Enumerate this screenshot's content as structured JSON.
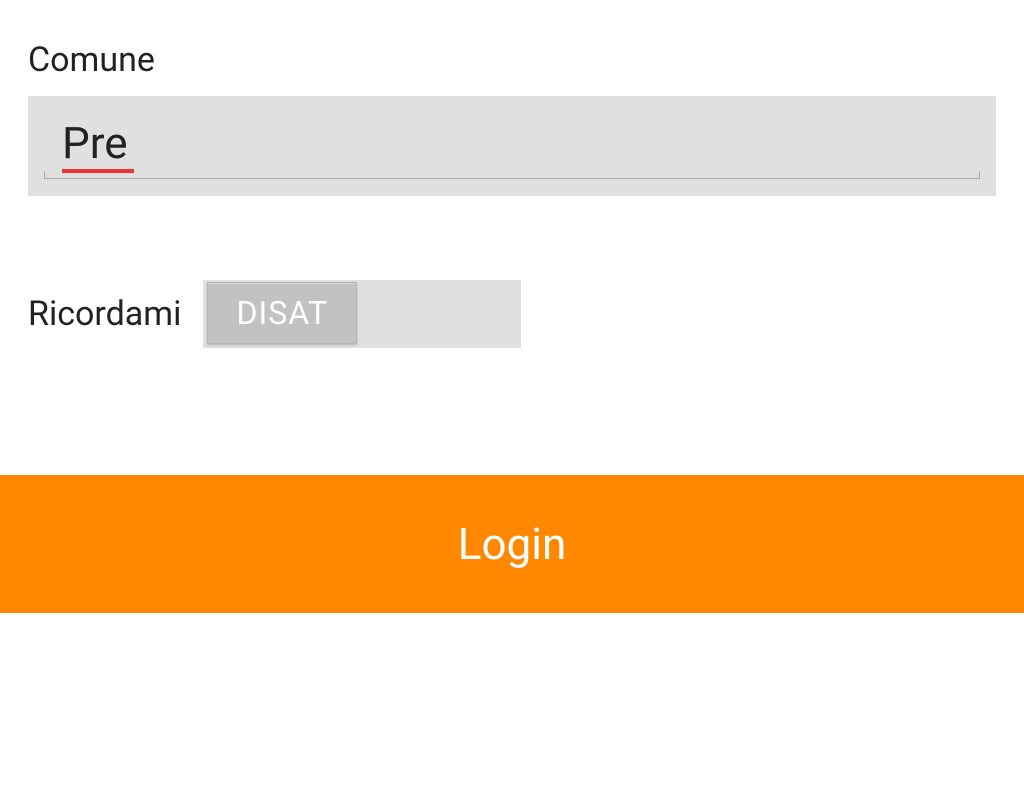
{
  "form": {
    "comune_label": "Comune",
    "comune_value": "Pre",
    "ricordami_label": "Ricordami",
    "toggle_state_label": "DISAT",
    "login_label": "Login"
  },
  "colors": {
    "accent": "#ff8800",
    "input_bg": "#e0e0e0",
    "thumb_bg": "#c2c2c2",
    "spell_error": "#ee3333"
  }
}
